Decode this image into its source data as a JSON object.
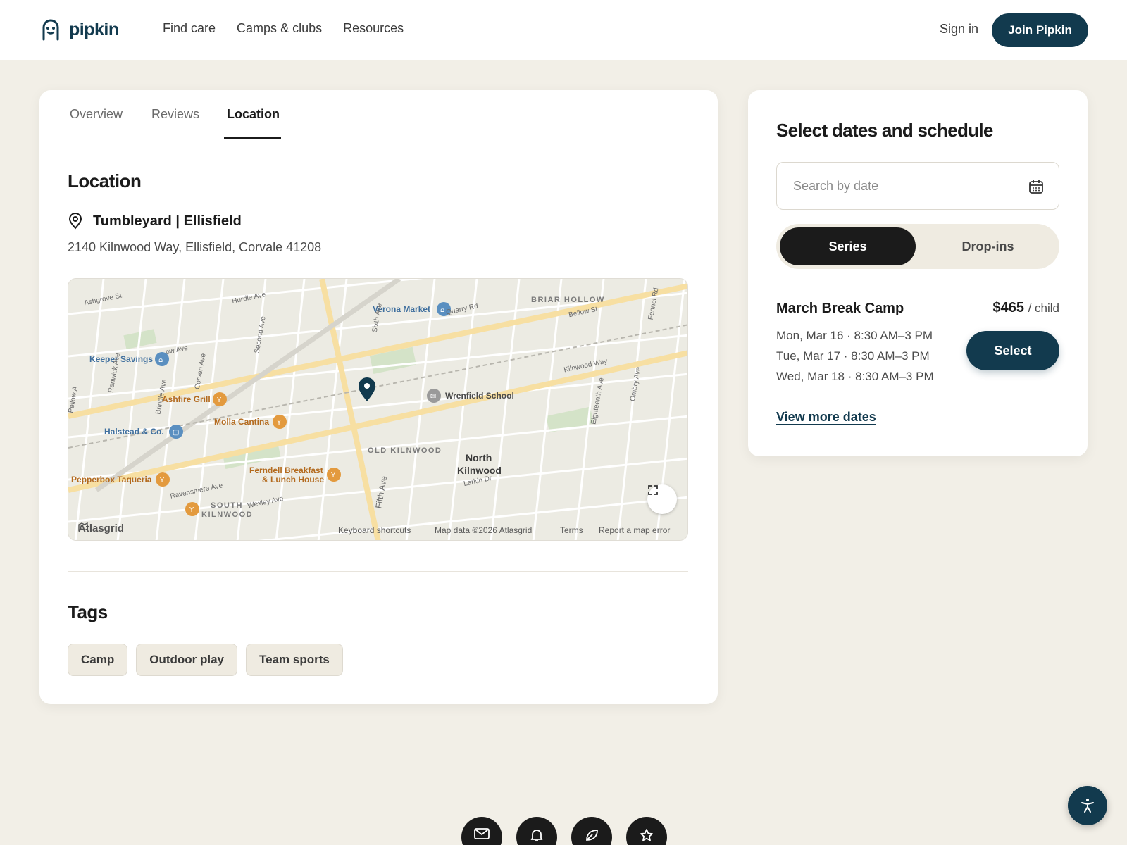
{
  "header": {
    "logo_text": "pipkin",
    "nav": [
      "Find care",
      "Camps & clubs",
      "Resources"
    ],
    "sign_in": "Sign in",
    "join": "Join Pipkin",
    "brand_color": "#123a4e"
  },
  "tabs": [
    "Overview",
    "Reviews",
    "Location"
  ],
  "active_tab": "Location",
  "location": {
    "heading": "Location",
    "venue_name": "Tumbleyard | Ellisfield",
    "address": "2140 Kilnwood Way, Ellisfield, Corvale 41208"
  },
  "map": {
    "brand": "Atlasgrid",
    "footer": [
      "Keyboard shortcuts",
      "Map data ©2026 Atlasgrid",
      "Terms",
      "Report a map error"
    ],
    "places": {
      "verona_market": "Verona Market",
      "keeper_savings": "Keeper Savings",
      "ashfire_grill": "Ashfire Grill",
      "molla_cantina": "Molla Cantina",
      "halstead": "Halstead & Co.",
      "wrenfield_school": "Wrenfield School",
      "pepperbox": "Pepperbox Taqueria",
      "ferndell_1": "Ferndell Breakfast",
      "ferndell_2": "& Lunch House"
    },
    "areas": {
      "briar_hollow": "BRIAR HOLLOW",
      "old_kilnwood": "OLD KILNWOOD",
      "north_kilnwood_1": "North",
      "north_kilnwood_2": "Kilnwood",
      "south_kilnwood_1": "SOUTH",
      "south_kilnwood_2": "KILNWOOD"
    },
    "streets": {
      "ashgrove": "Ashgrove St",
      "hurdle": "Hurdle Ave",
      "quarry": "Quarry Rd",
      "bellow": "Bellow St",
      "fennel": "Fennel Rd",
      "kilnwood_way": "Kilnwood Way",
      "second": "Second Ave",
      "sixth": "Sixth Ave",
      "fifth": "Fifth Ave",
      "eighteenth": "Eighteenth Ave",
      "ombry": "Ombry Ave",
      "larkin": "Larkin Dr",
      "ravensmere": "Ravensmere Ave",
      "wexley": "Wexley Ave",
      "renwick": "Renwick Ave",
      "brindle": "Brindle Ave",
      "corven": "Corven Ave",
      "willow": "ow Ave",
      "pellow": "Pellow A"
    }
  },
  "tags": {
    "heading": "Tags",
    "items": [
      "Camp",
      "Outdoor play",
      "Team sports"
    ]
  },
  "schedule": {
    "title": "Select dates and schedule",
    "search_placeholder": "Search by date",
    "toggle": [
      "Series",
      "Drop-ins"
    ],
    "session": {
      "name": "March Break Camp",
      "price": "$465",
      "price_unit": "/ child",
      "dates": [
        "Mon, Mar 16 · 8:30 AM–3 PM",
        "Tue, Mar 17 · 8:30 AM–3 PM",
        "Wed, Mar 18 · 8:30 AM–3 PM"
      ],
      "select_label": "Select"
    },
    "more_dates": "View more dates"
  },
  "icons": {
    "logo": "pipkin-logo-icon",
    "pin": "map-pin-icon",
    "calendar": "calendar-icon",
    "fullscreen": "fullscreen-icon",
    "accessibility": "accessibility-icon",
    "footer": [
      "mail-icon",
      "bell-icon",
      "leaf-icon",
      "star-icon"
    ]
  }
}
